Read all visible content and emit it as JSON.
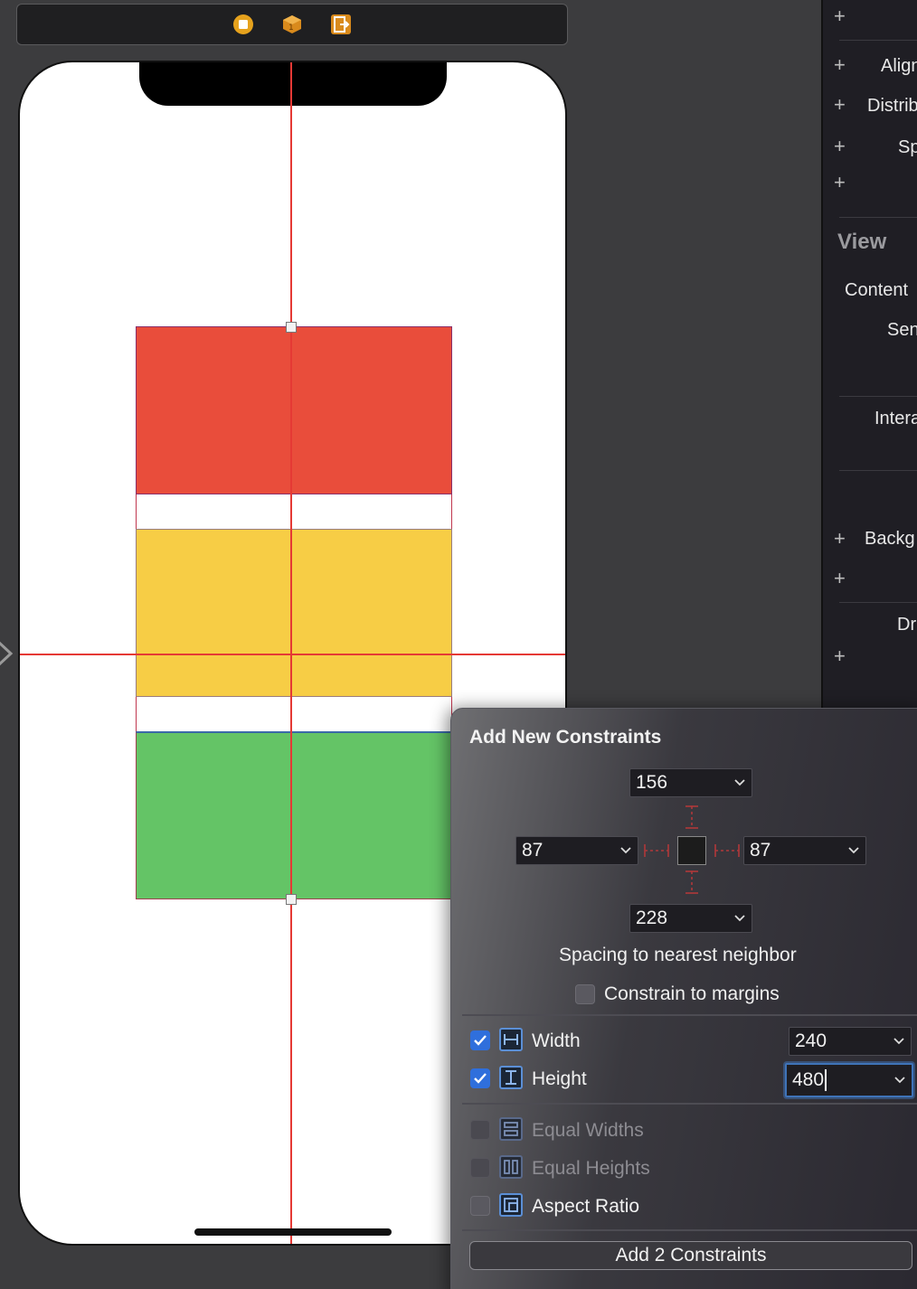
{
  "inspector": {
    "labels": [
      "Align",
      "Distrib",
      "Sp",
      "View",
      "Content",
      "Sen",
      "Intera",
      "Backg",
      "Dr"
    ]
  },
  "popover": {
    "title": "Add New Constraints",
    "spacing": {
      "top": "156",
      "left": "87",
      "right": "87",
      "bottom": "228"
    },
    "spacing_caption": "Spacing to nearest neighbor",
    "constrain_to_margins": {
      "label": "Constrain to margins",
      "checked": false
    },
    "rows": [
      {
        "label": "Width",
        "checked": true,
        "value": "240",
        "enabled": true
      },
      {
        "label": "Height",
        "checked": true,
        "value": "480",
        "enabled": true,
        "focused": true
      },
      {
        "label": "Equal Widths",
        "checked": false,
        "enabled": false
      },
      {
        "label": "Equal Heights",
        "checked": false,
        "enabled": false
      },
      {
        "label": "Aspect Ratio",
        "checked": false,
        "enabled": true
      }
    ],
    "add_button": "Add 2 Constraints"
  },
  "canvas": {
    "views": [
      {
        "name": "red-view",
        "color": "#e94d3b"
      },
      {
        "name": "yellow-view",
        "color": "#f7cd45"
      },
      {
        "name": "green-view",
        "color": "#64c466"
      }
    ],
    "guide_color": "#e53935"
  },
  "colors": {
    "accent": "#2f6fdc",
    "focus": "#3f73b8"
  }
}
